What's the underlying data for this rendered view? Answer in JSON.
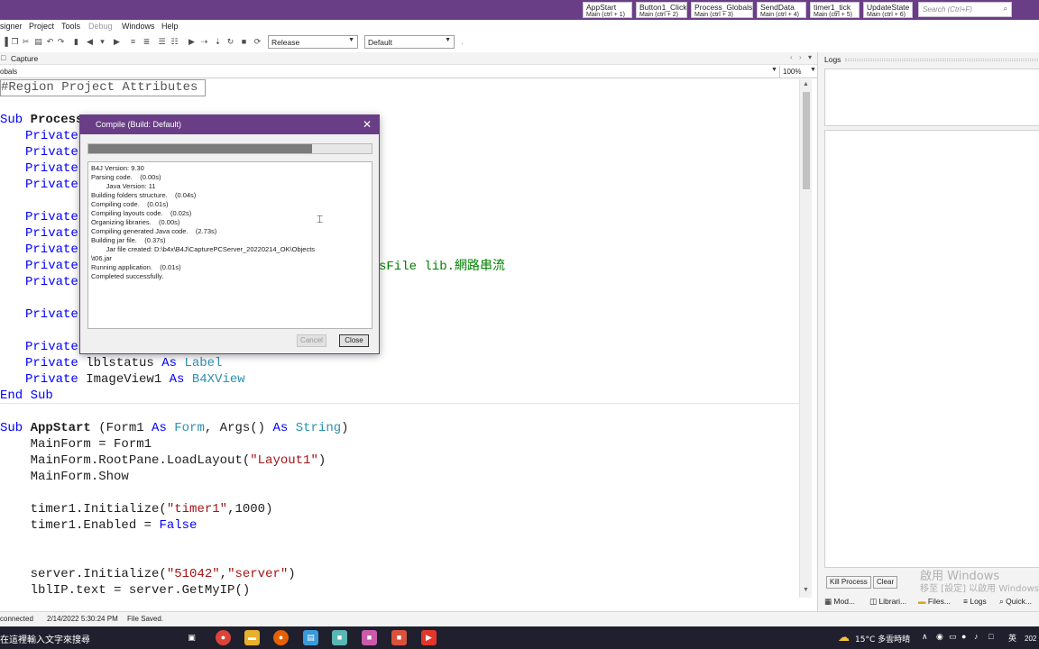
{
  "colors": {
    "accent": "#6a3e86",
    "keyword": "#0000ff",
    "type": "#2b91af",
    "string": "#a31515"
  },
  "quick_tabs": [
    {
      "title": "AppStart",
      "sub": "Main (ctrl + 1)"
    },
    {
      "title": "Button1_Click",
      "sub": "Main (ctrl + 2)"
    },
    {
      "title": "Process_Globals",
      "sub": "Main (ctrl + 3)"
    },
    {
      "title": "SendData",
      "sub": "Main (ctrl + 4)"
    },
    {
      "title": "timer1_tick",
      "sub": "Main (ctrl + 5)"
    },
    {
      "title": "UpdateState",
      "sub": "Main (ctrl + 6)"
    }
  ],
  "search": {
    "placeholder": "Search (Ctrl+F)",
    "icon": "search-icon"
  },
  "menu": {
    "designer": "signer",
    "project": "Project",
    "tools": "Tools",
    "debug": "Debug",
    "windows": "Windows",
    "help": "Help"
  },
  "toolbar": {
    "build_config": "Release",
    "device": "Default",
    "extra": "."
  },
  "doc_tab": {
    "label": "Capture"
  },
  "module_row": {
    "label": "obals",
    "zoom": "100%"
  },
  "code": {
    "region": "#Region Project Attributes",
    "sub_process_prefix": "Sub ",
    "sub_process_name": "Process_",
    "private": "Private",
    "files_comment": "sFile lib.",
    "files_comment_cjk": "網路串流",
    "lblstatus_decl": " lblstatus ",
    "as_kw": "As",
    "label_type": " Label",
    "imageview_decl": " ImageView1 ",
    "b4xview_type": " B4XView",
    "end_sub": "End Sub",
    "appstart_sub": "Sub ",
    "appstart_name": "AppStart",
    "appstart_args_1": " (Form1 ",
    "form_type": " Form",
    "appstart_args_2": ", Args() ",
    "string_type": " String",
    "appstart_args_3": ")",
    "mainform_assign": "    MainForm = Form1",
    "loadlayout_1": "    MainForm.RootPane.LoadLayout(",
    "loadlayout_str": "\"Layout1\"",
    "loadlayout_2": ")",
    "mainform_show": "    MainForm.Show",
    "timer_init_1": "    timer1.Initialize(",
    "timer_init_str": "\"timer1\"",
    "timer_init_2": ",1000)",
    "timer_enabled_1": "    timer1.Enabled = ",
    "false_kw": "False",
    "server_init_1": "    server.Initialize(",
    "server_init_str1": "\"51042\"",
    "server_init_mid": ",",
    "server_init_str2": "\"server\"",
    "server_init_2": ")",
    "lblip_line": "    lblIP.text = server.GetMyIP()"
  },
  "dialog": {
    "title": "Compile (Build: Default)",
    "progress_fraction": 0.79,
    "log": [
      "B4J Version: 9.30",
      "Parsing code.    (0.00s)",
      "        Java Version: 11",
      "Building folders structure.    (0.04s)",
      "Compiling code.    (0.01s)",
      "Compiling layouts code.    (0.02s)",
      "Organizing libraries.    (0.00s)",
      "Compiling generated Java code.    (2.73s)",
      "Building jar file.    (0.37s)",
      "        Jar file created: D:\\b4x\\B4J\\CapturePCServer_20220214_OK\\Objects",
      "\\t06.jar",
      "Running application.    (0.01s)",
      "Completed successfully."
    ],
    "cancel": "Cancel",
    "close": "Close"
  },
  "logs_panel": {
    "title": "Logs",
    "kill_process": "Kill Process",
    "clear": "Clear",
    "tabs": [
      "Mod...",
      "Librari...",
      "Files...",
      "Logs",
      "Quick..."
    ]
  },
  "watermark": {
    "line1": "啟用 Windows",
    "line2": "移至 [設定] 以啟用 Windows"
  },
  "status": {
    "connection": "connected",
    "timestamp": "2/14/2022 5:30:24 PM",
    "message": "File Saved."
  },
  "taskbar": {
    "search_text": "在這裡輸入文字來搜尋",
    "weather": "15°C  多雲時晴",
    "lang": "英",
    "clock": "202"
  }
}
